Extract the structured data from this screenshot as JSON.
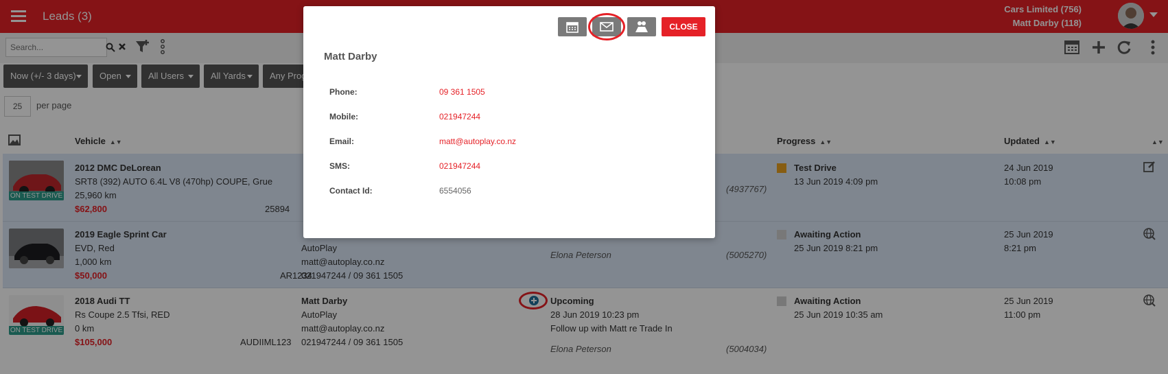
{
  "header": {
    "title": "Leads (3)",
    "account": "Cars Limited (756)",
    "user": "Matt Darby (118)"
  },
  "search": {
    "placeholder": "Search..."
  },
  "filters": [
    "Now (+/- 3 days)",
    "Open",
    "All Users",
    "All Yards",
    "Any Progress"
  ],
  "paging": {
    "per_page_value": "25",
    "per_page_label": "per page"
  },
  "columns": {
    "vehicle": "Vehicle",
    "progress": "Progress",
    "updated": "Updated"
  },
  "rows": [
    {
      "title": "2012 DMC DeLorean",
      "desc": "SRT8 (392) AUTO 6.4L V8 (470hp) COUPE, Grue",
      "km": "25,960 km",
      "price": "$62,800",
      "stock": "25894",
      "badge": "ON TEST DRIVE",
      "customer": "",
      "company": "",
      "email": "",
      "phones": "",
      "activity_title": "",
      "activity_date": "",
      "activity_note": "",
      "agent": "",
      "activity_id": "(4937767)",
      "progress": "Test Drive",
      "progress_date": "13 Jun 2019 4:09 pm",
      "progress_color": "#e8a020",
      "updated_date": "24 Jun 2019",
      "updated_time": "10:08 pm"
    },
    {
      "title": "2019 Eagle Sprint Car",
      "desc": "EVD, Red",
      "km": "1,000 km",
      "price": "$50,000",
      "stock": "AR1234",
      "badge": "",
      "customer": "",
      "company": "AutoPlay",
      "email": "matt@autoplay.co.nz",
      "phones": "021947244 / 09 361 1505",
      "activity_title": "",
      "activity_date": "",
      "activity_note": "",
      "agent": "Elona Peterson",
      "activity_id": "(5005270)",
      "progress": "Awaiting Action",
      "progress_date": "25 Jun 2019 8:21 pm",
      "progress_color": "#cfcfcf",
      "updated_date": "25 Jun 2019",
      "updated_time": "8:21 pm"
    },
    {
      "title": "2018 Audi TT",
      "desc": "Rs Coupe 2.5 Tfsi, RED",
      "km": "0 km",
      "price": "$105,000",
      "stock": "AUDIIML123",
      "badge": "ON TEST DRIVE",
      "customer": "Matt Darby",
      "company": "AutoPlay",
      "email": "matt@autoplay.co.nz",
      "phones": "021947244 / 09 361 1505",
      "activity_title": "Upcoming",
      "activity_date": "28 Jun 2019 10:23 pm",
      "activity_note": "Follow up with Matt re Trade In",
      "agent": "Elona Peterson",
      "activity_id": "(5004034)",
      "progress": "Awaiting Action",
      "progress_date": "25 Jun 2019 10:35 am",
      "progress_color": "#cfcfcf",
      "updated_date": "25 Jun 2019",
      "updated_time": "11:00 pm"
    }
  ],
  "modal": {
    "name": "Matt Darby",
    "close_label": "CLOSE",
    "fields": [
      {
        "label": "Phone:",
        "value": "09 361 1505"
      },
      {
        "label": "Mobile:",
        "value": "021947244"
      },
      {
        "label": "Email:",
        "value": "matt@autoplay.co.nz"
      },
      {
        "label": "SMS:",
        "value": "021947244"
      },
      {
        "label": "Contact Id:",
        "value": "6554056"
      }
    ]
  },
  "colors": {
    "brand": "#e52127",
    "row_selected": "#dbe7f7",
    "badge": "#2c9c8a"
  },
  "icons": [
    "menu-icon",
    "search-icon",
    "clear-icon",
    "filter-add-icon",
    "more-vert-icon",
    "calendar-icon",
    "add-icon",
    "refresh-icon",
    "image-icon",
    "edit-icon",
    "globe-icon",
    "add-circle-icon",
    "email-icon",
    "handshake-icon"
  ]
}
